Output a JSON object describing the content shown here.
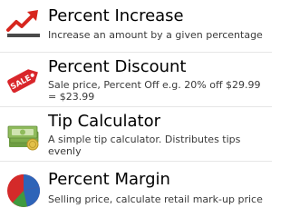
{
  "items": [
    {
      "title": "Percent Increase",
      "subtitle": "Increase an amount by a given percentage",
      "icon": "trend-up-arrow-icon"
    },
    {
      "title": "Percent Discount",
      "subtitle": "Sale price, Percent Off e.g. 20% off $29.99 = $23.99",
      "icon": "sale-tag-icon",
      "icon_text": "SALE"
    },
    {
      "title": "Tip Calculator",
      "subtitle": "A simple tip calculator. Distributes tips evenly",
      "icon": "money-stack-icon"
    },
    {
      "title": "Percent Margin",
      "subtitle": "Selling price, calculate retail mark-up price",
      "icon": "pie-chart-icon"
    }
  ],
  "colors": {
    "trend_red": "#d7261e",
    "trend_base": "#4a4a4a",
    "tag_red": "#d9262b",
    "money_green": "#7fae4f",
    "money_light": "#cfe3b0",
    "pie_red": "#d42a2a",
    "pie_blue": "#2e64b8",
    "pie_green": "#3f9a3f"
  }
}
